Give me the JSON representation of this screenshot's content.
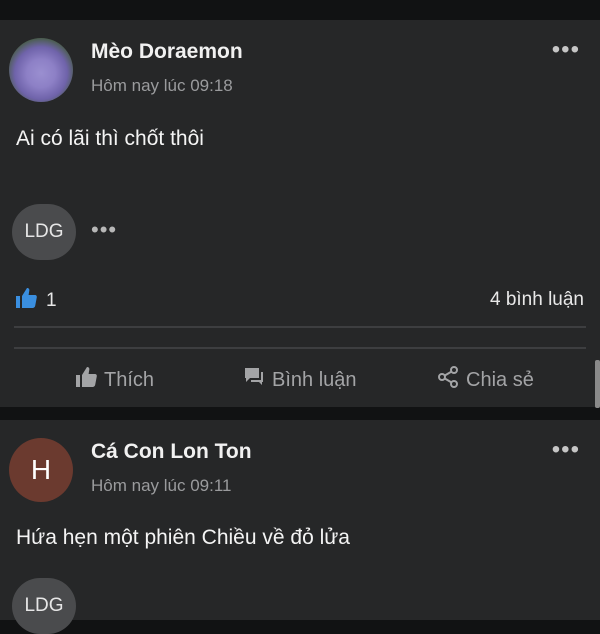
{
  "posts": [
    {
      "author": "Mèo Doraemon",
      "time": "Hôm nay lúc 09:18",
      "content": "Ai có lãi thì chốt thôi",
      "reactor_initials": "LDG",
      "like_count": "1",
      "comment_count": "4 bình luận",
      "actions": {
        "like": "Thích",
        "comment": "Bình luận",
        "share": "Chia sẻ"
      }
    },
    {
      "author": "Cá Con Lon Ton",
      "avatar_letter": "H",
      "time": "Hôm nay lúc 09:11",
      "content": "Hứa hẹn một phiên Chiều về đỏ lửa",
      "reactor_initials": "LDG"
    }
  ],
  "icons": {
    "more": "more-horizontal-icon",
    "like": "thumbs-up-icon",
    "comment": "comment-icon",
    "share": "share-icon"
  },
  "colors": {
    "background": "#111213",
    "card": "#262728",
    "like_blue": "#3a8fe0",
    "secondary_text": "#9a9b9d"
  }
}
